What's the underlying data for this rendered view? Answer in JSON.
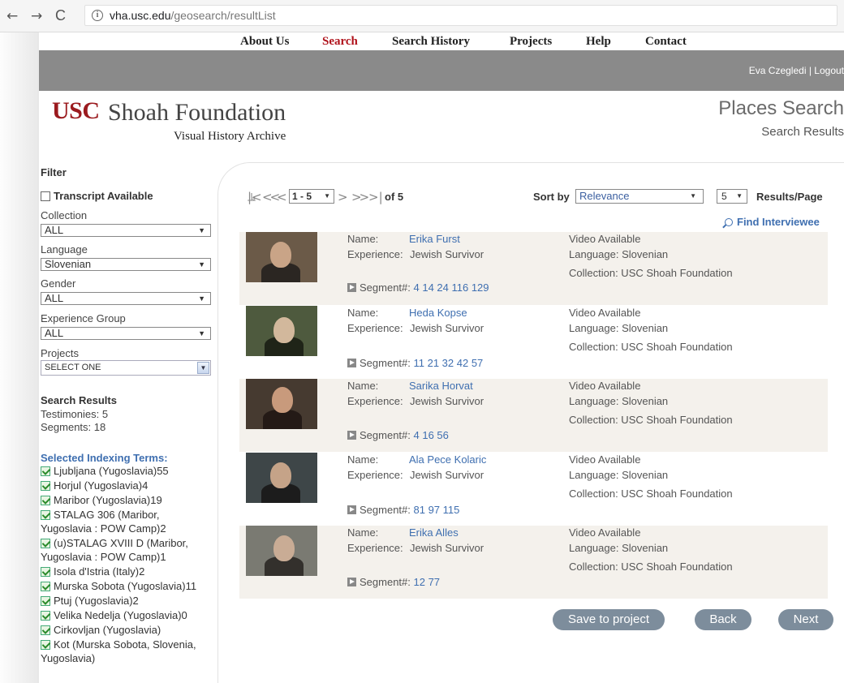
{
  "browser": {
    "back": "←",
    "forward": "→",
    "reload": "C",
    "url_host": "vha.usc.edu",
    "url_path": "/geosearch/resultList"
  },
  "nav": [
    "About Us",
    "Search",
    "Search History",
    "Projects",
    "Help",
    "Contact"
  ],
  "nav_active": "Search",
  "user": {
    "name": "Eva Czegledi",
    "separator": " | ",
    "logout": "Logout"
  },
  "logo": {
    "usc": "USC",
    "org": "Shoah Foundation",
    "subtitle": "Visual History Archive"
  },
  "page": {
    "title": "Places Search",
    "subtitle": "Search Results"
  },
  "filter": {
    "heading": "Filter",
    "transcript_label": "Transcript Available",
    "collection_label": "Collection",
    "collection_value": "ALL",
    "language_label": "Language",
    "language_value": "Slovenian",
    "gender_label": "Gender",
    "gender_value": "ALL",
    "experience_label": "Experience Group",
    "experience_value": "ALL",
    "projects_label": "Projects",
    "projects_value": "SELECT ONE"
  },
  "search_results": {
    "heading": "Search Results",
    "testimonies": "Testimonies: 5",
    "segments": "Segments: 18"
  },
  "indexing": {
    "heading": "Selected Indexing Terms:",
    "terms": [
      [
        "Ljubljana (Yugoslavia)55"
      ],
      [
        "Horjul (Yugoslavia)4"
      ],
      [
        "Maribor (Yugoslavia)19"
      ],
      [
        "STALAG 306 (Maribor,",
        "Yugoslavia : POW Camp)2"
      ],
      [
        "(u)STALAG XVIII D (Maribor,",
        "Yugoslavia : POW Camp)1"
      ],
      [
        "Isola d'Istria (Italy)2"
      ],
      [
        "Murska Sobota (Yugoslavia)11"
      ],
      [
        "Ptuj (Yugoslavia)2"
      ],
      [
        "Velika Nedelja (Yugoslavia)0"
      ],
      [
        "Cirkovljan (Yugoslavia)"
      ],
      [
        "Kot (Murska Sobota, Slovenia,",
        "Yugoslavia)"
      ]
    ]
  },
  "pager": {
    "first": "|<",
    "prev_many": "<<",
    "prev": "<",
    "range": "1 - 5",
    "next": ">",
    "next_many": ">>",
    "last": ">|",
    "of": "of 5"
  },
  "sort": {
    "label": "Sort by",
    "value": "Relevance",
    "per_page": "5",
    "per_page_label": "Results/Page"
  },
  "find_interviewee": "Find Interviewee",
  "labels": {
    "name": "Name:",
    "experience": "Experience:",
    "segment": "Segment#:"
  },
  "results": [
    {
      "name": "Erika Furst",
      "experience": "Jewish Survivor",
      "video": "Video Available",
      "language": "Language: Slovenian",
      "collection": "Collection: USC Shoah Foundation",
      "segments": "4 14 24 116 129"
    },
    {
      "name": "Heda Kopse",
      "experience": "Jewish Survivor",
      "video": "Video Available",
      "language": "Language: Slovenian",
      "collection": "Collection: USC Shoah Foundation",
      "segments": "11 21 32 42 57"
    },
    {
      "name": "Sarika Horvat",
      "experience": "Jewish Survivor",
      "video": "Video Available",
      "language": "Language: Slovenian",
      "collection": "Collection: USC Shoah Foundation",
      "segments": "4 16 56"
    },
    {
      "name": "Ala Pece Kolaric",
      "experience": "Jewish Survivor",
      "video": "Video Available",
      "language": "Language: Slovenian",
      "collection": "Collection: USC Shoah Foundation",
      "segments": "81 97 115"
    },
    {
      "name": "Erika Alles",
      "experience": "Jewish Survivor",
      "video": "Video Available",
      "language": "Language: Slovenian",
      "collection": "Collection: USC Shoah Foundation",
      "segments": "12 77"
    }
  ],
  "buttons": {
    "save": "Save to project",
    "back": "Back",
    "next": "Next"
  },
  "colors": {
    "accent_red": "#b0121b",
    "link_blue": "#3f6fb0",
    "button_gray": "#7d8d9c",
    "header_gray": "#8a8a8a"
  }
}
